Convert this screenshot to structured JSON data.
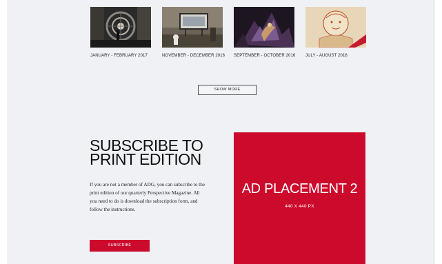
{
  "issues": [
    {
      "caption": "JANUARY - FEBRUARY 2017"
    },
    {
      "caption": "NOVEMBER - DECEMBER 2016"
    },
    {
      "caption": "SEPTEMBER - OCTOBER 2016"
    },
    {
      "caption": "JULY - AUGUST 2016"
    }
  ],
  "show_more_label": "SHOW MORE",
  "subscribe": {
    "title_line1": "SUBSCRIBE TO",
    "title_line2": "PRINT EDITION",
    "text": "If you are not a member of ADG, you can subscribe to the print edition of our quarterly Perspective Magazine. All you need to do is download the subscription form, and follow the instructions.",
    "button_label": "SUBSCRIBE"
  },
  "ad": {
    "title": "AD PLACEMENT 2",
    "size": "440 X 440 PX"
  },
  "colors": {
    "accent": "#cc0a2c",
    "background": "#eff1f4"
  }
}
